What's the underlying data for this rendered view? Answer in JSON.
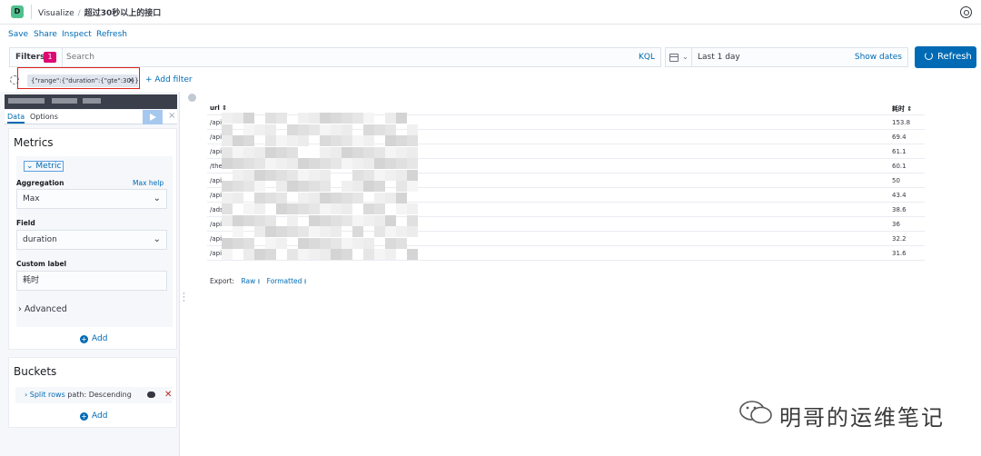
{
  "header": {
    "space_badge": "D",
    "breadcrumb_root": "Visualize",
    "breadcrumb_sep": "/",
    "breadcrumb_current": "超过30秒以上的接口"
  },
  "menu": {
    "save": "Save",
    "share": "Share",
    "inspect": "Inspect",
    "refresh": "Refresh"
  },
  "query": {
    "filters_label": "Filters",
    "filters_count": "1",
    "search_placeholder": "Search",
    "language": "KQL"
  },
  "time": {
    "range": "Last 1 day",
    "show_dates": "Show dates",
    "refresh_button": "Refresh"
  },
  "filters": {
    "pill_text": "{\"range\":{\"duration\":{\"gte\":30}}}",
    "pill_close": "×",
    "add_filter": "+ Add filter"
  },
  "editor": {
    "tab_data": "Data",
    "tab_options": "Options",
    "close": "×",
    "metrics_title": "Metrics",
    "metric_label": "Metric",
    "aggregation_label": "Aggregation",
    "max_help": "Max help",
    "aggregation_value": "Max",
    "field_label": "Field",
    "field_value": "duration",
    "custom_label_label": "Custom label",
    "custom_label_value": "耗时",
    "advanced": "Advanced",
    "add": "Add",
    "buckets_title": "Buckets",
    "split_rows_link": "Split rows",
    "split_rows_desc": "path: Descending"
  },
  "table": {
    "col_url": "url",
    "col_duration": "耗时",
    "rows": [
      {
        "url": "/api",
        "duration": "153.8"
      },
      {
        "url": "/api",
        "duration": "69.4"
      },
      {
        "url": "/api",
        "duration": "61.1"
      },
      {
        "url": "/the",
        "duration": "60.1"
      },
      {
        "url": "/api",
        "duration": "50"
      },
      {
        "url": "/api",
        "duration": "43.4"
      },
      {
        "url": "/ads",
        "duration": "38.6"
      },
      {
        "url": "/api",
        "duration": "36"
      },
      {
        "url": "/api",
        "duration": "32.2"
      },
      {
        "url": "/api",
        "duration": "31.6"
      }
    ]
  },
  "export": {
    "label": "Export:",
    "raw": "Raw",
    "formatted": "Formatted"
  },
  "watermark": "明哥的运维笔记",
  "colors": {
    "accent": "#006bb4",
    "badge": "#dd0a73",
    "highlight": "#e2211c"
  }
}
